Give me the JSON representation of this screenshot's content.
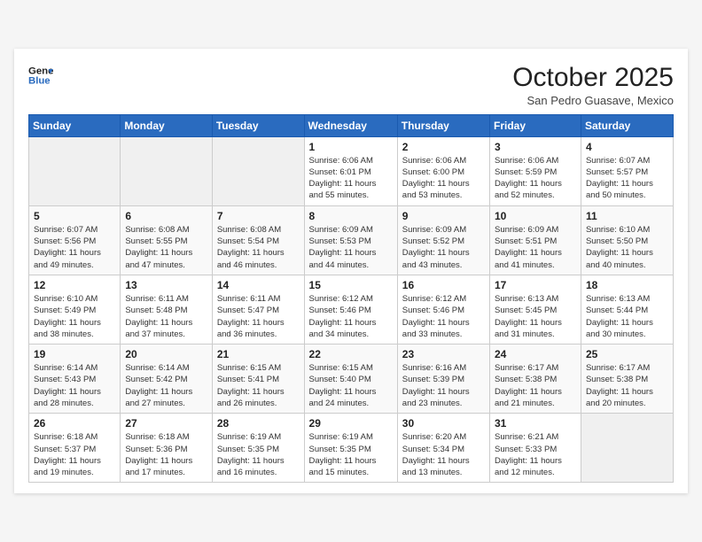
{
  "header": {
    "logo_line1": "General",
    "logo_line2": "Blue",
    "month": "October 2025",
    "location": "San Pedro Guasave, Mexico"
  },
  "weekdays": [
    "Sunday",
    "Monday",
    "Tuesday",
    "Wednesday",
    "Thursday",
    "Friday",
    "Saturday"
  ],
  "weeks": [
    [
      {
        "day": "",
        "info": ""
      },
      {
        "day": "",
        "info": ""
      },
      {
        "day": "",
        "info": ""
      },
      {
        "day": "1",
        "info": "Sunrise: 6:06 AM\nSunset: 6:01 PM\nDaylight: 11 hours\nand 55 minutes."
      },
      {
        "day": "2",
        "info": "Sunrise: 6:06 AM\nSunset: 6:00 PM\nDaylight: 11 hours\nand 53 minutes."
      },
      {
        "day": "3",
        "info": "Sunrise: 6:06 AM\nSunset: 5:59 PM\nDaylight: 11 hours\nand 52 minutes."
      },
      {
        "day": "4",
        "info": "Sunrise: 6:07 AM\nSunset: 5:57 PM\nDaylight: 11 hours\nand 50 minutes."
      }
    ],
    [
      {
        "day": "5",
        "info": "Sunrise: 6:07 AM\nSunset: 5:56 PM\nDaylight: 11 hours\nand 49 minutes."
      },
      {
        "day": "6",
        "info": "Sunrise: 6:08 AM\nSunset: 5:55 PM\nDaylight: 11 hours\nand 47 minutes."
      },
      {
        "day": "7",
        "info": "Sunrise: 6:08 AM\nSunset: 5:54 PM\nDaylight: 11 hours\nand 46 minutes."
      },
      {
        "day": "8",
        "info": "Sunrise: 6:09 AM\nSunset: 5:53 PM\nDaylight: 11 hours\nand 44 minutes."
      },
      {
        "day": "9",
        "info": "Sunrise: 6:09 AM\nSunset: 5:52 PM\nDaylight: 11 hours\nand 43 minutes."
      },
      {
        "day": "10",
        "info": "Sunrise: 6:09 AM\nSunset: 5:51 PM\nDaylight: 11 hours\nand 41 minutes."
      },
      {
        "day": "11",
        "info": "Sunrise: 6:10 AM\nSunset: 5:50 PM\nDaylight: 11 hours\nand 40 minutes."
      }
    ],
    [
      {
        "day": "12",
        "info": "Sunrise: 6:10 AM\nSunset: 5:49 PM\nDaylight: 11 hours\nand 38 minutes."
      },
      {
        "day": "13",
        "info": "Sunrise: 6:11 AM\nSunset: 5:48 PM\nDaylight: 11 hours\nand 37 minutes."
      },
      {
        "day": "14",
        "info": "Sunrise: 6:11 AM\nSunset: 5:47 PM\nDaylight: 11 hours\nand 36 minutes."
      },
      {
        "day": "15",
        "info": "Sunrise: 6:12 AM\nSunset: 5:46 PM\nDaylight: 11 hours\nand 34 minutes."
      },
      {
        "day": "16",
        "info": "Sunrise: 6:12 AM\nSunset: 5:46 PM\nDaylight: 11 hours\nand 33 minutes."
      },
      {
        "day": "17",
        "info": "Sunrise: 6:13 AM\nSunset: 5:45 PM\nDaylight: 11 hours\nand 31 minutes."
      },
      {
        "day": "18",
        "info": "Sunrise: 6:13 AM\nSunset: 5:44 PM\nDaylight: 11 hours\nand 30 minutes."
      }
    ],
    [
      {
        "day": "19",
        "info": "Sunrise: 6:14 AM\nSunset: 5:43 PM\nDaylight: 11 hours\nand 28 minutes."
      },
      {
        "day": "20",
        "info": "Sunrise: 6:14 AM\nSunset: 5:42 PM\nDaylight: 11 hours\nand 27 minutes."
      },
      {
        "day": "21",
        "info": "Sunrise: 6:15 AM\nSunset: 5:41 PM\nDaylight: 11 hours\nand 26 minutes."
      },
      {
        "day": "22",
        "info": "Sunrise: 6:15 AM\nSunset: 5:40 PM\nDaylight: 11 hours\nand 24 minutes."
      },
      {
        "day": "23",
        "info": "Sunrise: 6:16 AM\nSunset: 5:39 PM\nDaylight: 11 hours\nand 23 minutes."
      },
      {
        "day": "24",
        "info": "Sunrise: 6:17 AM\nSunset: 5:38 PM\nDaylight: 11 hours\nand 21 minutes."
      },
      {
        "day": "25",
        "info": "Sunrise: 6:17 AM\nSunset: 5:38 PM\nDaylight: 11 hours\nand 20 minutes."
      }
    ],
    [
      {
        "day": "26",
        "info": "Sunrise: 6:18 AM\nSunset: 5:37 PM\nDaylight: 11 hours\nand 19 minutes."
      },
      {
        "day": "27",
        "info": "Sunrise: 6:18 AM\nSunset: 5:36 PM\nDaylight: 11 hours\nand 17 minutes."
      },
      {
        "day": "28",
        "info": "Sunrise: 6:19 AM\nSunset: 5:35 PM\nDaylight: 11 hours\nand 16 minutes."
      },
      {
        "day": "29",
        "info": "Sunrise: 6:19 AM\nSunset: 5:35 PM\nDaylight: 11 hours\nand 15 minutes."
      },
      {
        "day": "30",
        "info": "Sunrise: 6:20 AM\nSunset: 5:34 PM\nDaylight: 11 hours\nand 13 minutes."
      },
      {
        "day": "31",
        "info": "Sunrise: 6:21 AM\nSunset: 5:33 PM\nDaylight: 11 hours\nand 12 minutes."
      },
      {
        "day": "",
        "info": ""
      }
    ]
  ]
}
